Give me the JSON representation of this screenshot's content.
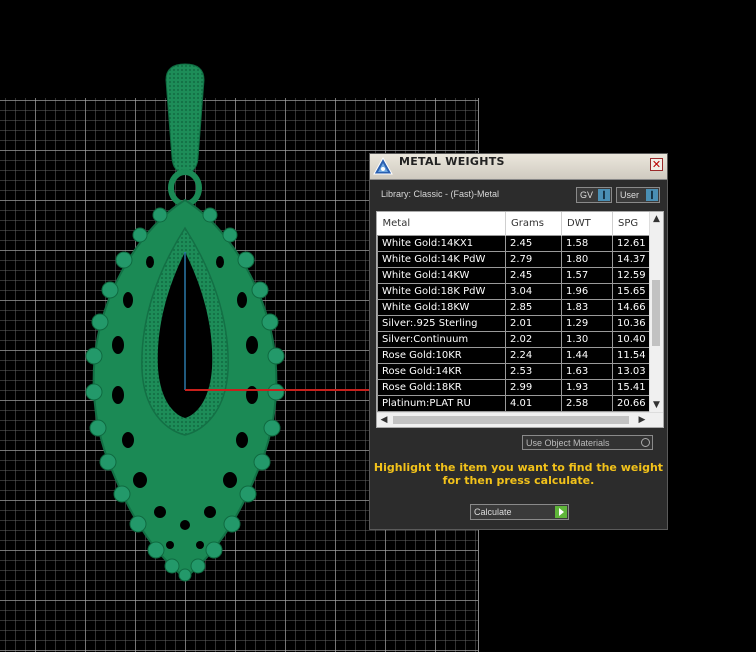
{
  "panel": {
    "title": "METAL WEIGHTS",
    "close_glyph": "✕",
    "library_text": "Library: Classic - (Fast)-Metal",
    "gv_label": "GV",
    "user_label": "User",
    "use_object_materials": "Use Object Materials",
    "instructions_line1": "Highlight the item you want to find the weight",
    "instructions_line2": "for then press calculate.",
    "calculate_label": "Calculate"
  },
  "table": {
    "columns": [
      "Metal",
      "Grams",
      "DWT",
      "SPG"
    ],
    "rows": [
      [
        "White Gold:14KX1",
        "2.45",
        "1.58",
        "12.61"
      ],
      [
        "White Gold:14K PdW",
        "2.79",
        "1.80",
        "14.37"
      ],
      [
        "White Gold:14KW",
        "2.45",
        "1.57",
        "12.59"
      ],
      [
        "White Gold:18K PdW",
        "3.04",
        "1.96",
        "15.65"
      ],
      [
        "White Gold:18KW",
        "2.85",
        "1.83",
        "14.66"
      ],
      [
        "Silver:.925 Sterling",
        "2.01",
        "1.29",
        "10.36"
      ],
      [
        "Silver:Continuum",
        "2.02",
        "1.30",
        "10.40"
      ],
      [
        "Rose Gold:10KR",
        "2.24",
        "1.44",
        "11.54"
      ],
      [
        "Rose Gold:14KR",
        "2.53",
        "1.63",
        "13.03"
      ],
      [
        "Rose Gold:18KR",
        "2.99",
        "1.93",
        "15.41"
      ],
      [
        "Platinum:PLAT RU",
        "4.01",
        "2.58",
        "20.66"
      ]
    ]
  },
  "colors": {
    "model_green": "#1b8a55",
    "instructions_yellow": "#f2c21a",
    "accent_blue": "#4a8fb4",
    "play_green": "#5fb53a"
  }
}
